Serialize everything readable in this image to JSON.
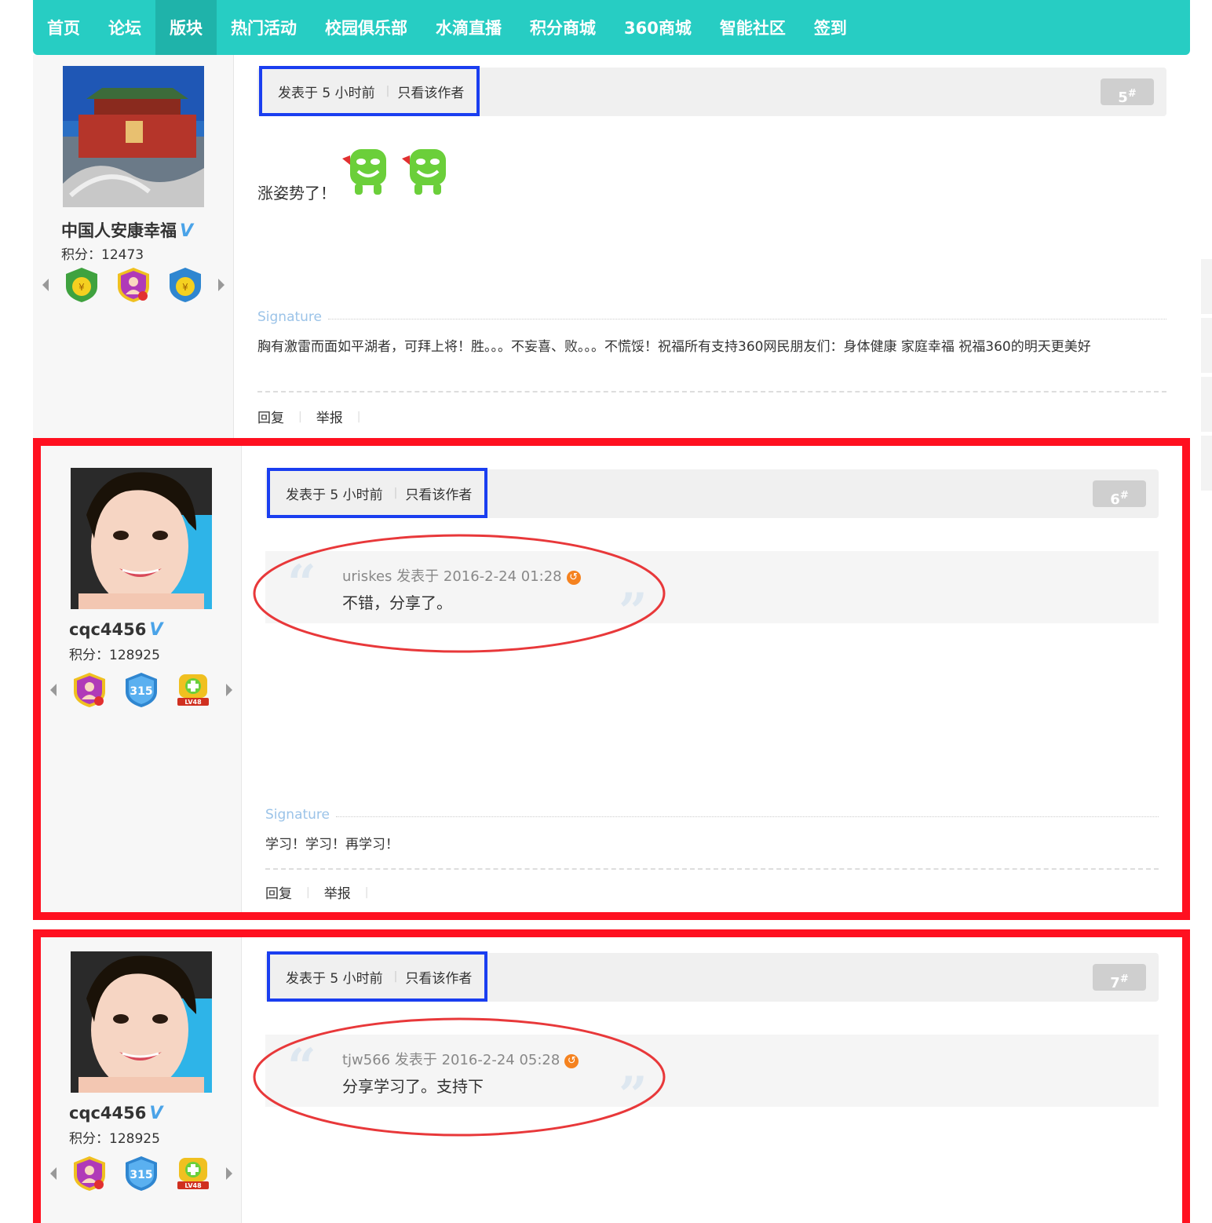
{
  "nav": {
    "items": [
      "首页",
      "论坛",
      "版块",
      "热门活动",
      "校园俱乐部",
      "水滴直播",
      "积分商城",
      "360商城",
      "智能社区",
      "签到"
    ],
    "active": "版块"
  },
  "colors": {
    "nav_bg": "#27cdc3",
    "highlight_red": "#ff1020",
    "highlight_blue": "#1a3ef0"
  },
  "posts": [
    {
      "user": {
        "name": "中国人安康幸福",
        "score_label": "积分：",
        "score": "12473",
        "verified_mark": "V"
      },
      "meta": {
        "time": "发表于 5 小时前",
        "only_author": "只看该作者"
      },
      "floor": "5",
      "floor_mark": "#",
      "content": "涨姿势了！",
      "signature_label": "Signature",
      "signature": "胸有激雷而面如平湖者，可拜上将！胜。。。不妄喜、败。。。不慌馁！祝福所有支持360网民朋友们：身体健康  家庭幸福   祝福360的明天更美好",
      "actions": [
        "回复",
        "举报"
      ]
    },
    {
      "user": {
        "name": "cqc4456",
        "score_label": "积分：",
        "score": "128925",
        "verified_mark": "V"
      },
      "meta": {
        "time": "发表于 5 小时前",
        "only_author": "只看该作者"
      },
      "floor": "6",
      "floor_mark": "#",
      "quote": {
        "meta": "uriskes 发表于 2016-2-24 01:28",
        "text": "不错，分享了。"
      },
      "signature_label": "Signature",
      "signature": "学习！学习！再学习！",
      "actions": [
        "回复",
        "举报"
      ]
    },
    {
      "user": {
        "name": "cqc4456",
        "score_label": "积分：",
        "score": "128925",
        "verified_mark": "V"
      },
      "meta": {
        "time": "发表于 5 小时前",
        "only_author": "只看该作者"
      },
      "floor": "7",
      "floor_mark": "#",
      "quote": {
        "meta": "tjw566 发表于 2016-2-24 05:28",
        "text": "分享学习了。支持下"
      }
    }
  ]
}
